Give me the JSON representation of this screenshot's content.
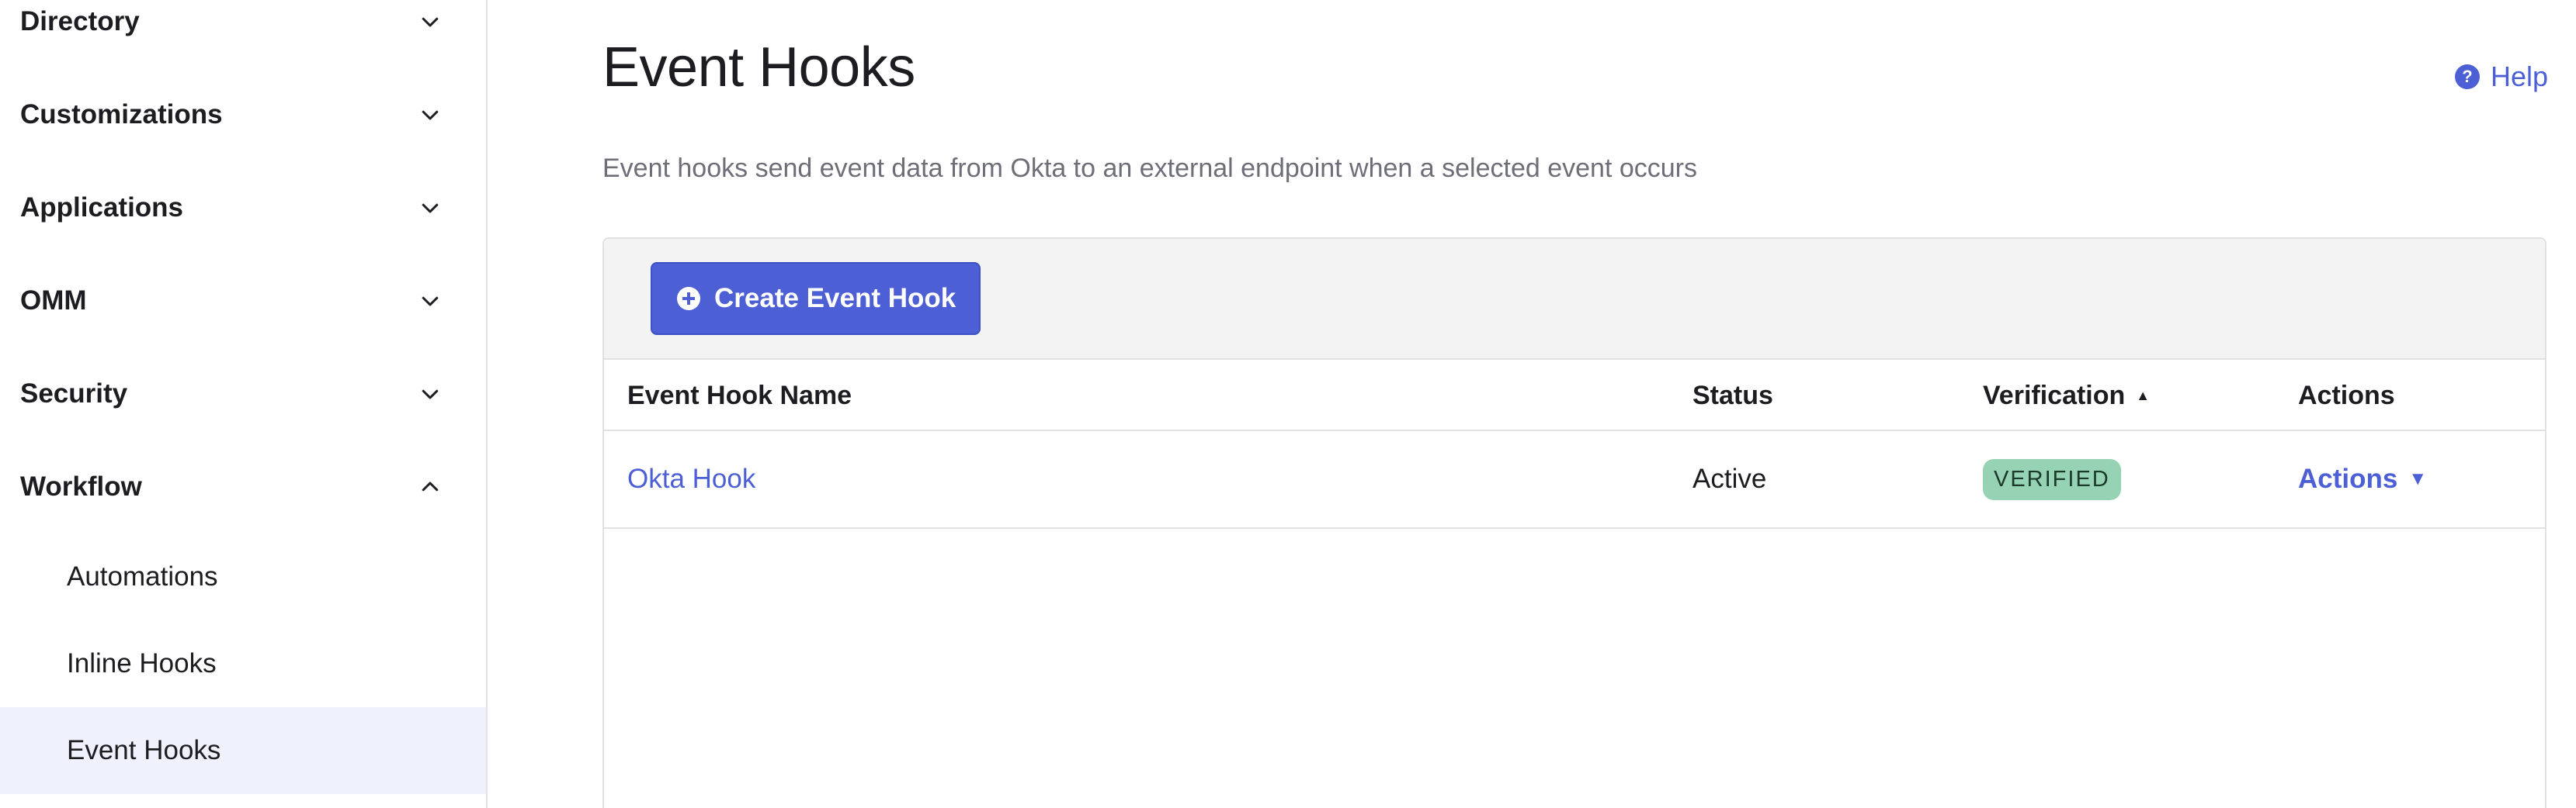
{
  "sidebar": {
    "groups": [
      {
        "label": "Directory",
        "expanded": false,
        "icon": "chevron-down-icon"
      },
      {
        "label": "Customizations",
        "expanded": false,
        "icon": "chevron-down-icon"
      },
      {
        "label": "Applications",
        "expanded": false,
        "icon": "chevron-down-icon"
      },
      {
        "label": "OMM",
        "expanded": false,
        "icon": "chevron-down-icon"
      },
      {
        "label": "Security",
        "expanded": false,
        "icon": "chevron-down-icon"
      },
      {
        "label": "Workflow",
        "expanded": true,
        "icon": "chevron-up-icon"
      }
    ],
    "workflow_items": [
      {
        "label": "Automations",
        "active": false
      },
      {
        "label": "Inline Hooks",
        "active": false
      },
      {
        "label": "Event Hooks",
        "active": true
      }
    ]
  },
  "page": {
    "title": "Event Hooks",
    "help_label": "Help",
    "help_icon": "?",
    "description": "Event hooks send event data from Okta to an external endpoint when a selected event occurs"
  },
  "toolbar": {
    "create_label": "Create Event Hook",
    "create_icon": "plus-circle-icon"
  },
  "table": {
    "columns": [
      "Event Hook Name",
      "Status",
      "Verification",
      "Actions"
    ],
    "sort_indicator": "▲",
    "rows": [
      {
        "name": "Okta Hook",
        "status": "Active",
        "verification": "VERIFIED",
        "actions_label": "Actions",
        "actions_caret": "▼"
      }
    ]
  },
  "colors": {
    "accent": "#4c5fd5",
    "verified_badge": "#96d3b4",
    "active_nav_bg": "#eff2fd"
  }
}
